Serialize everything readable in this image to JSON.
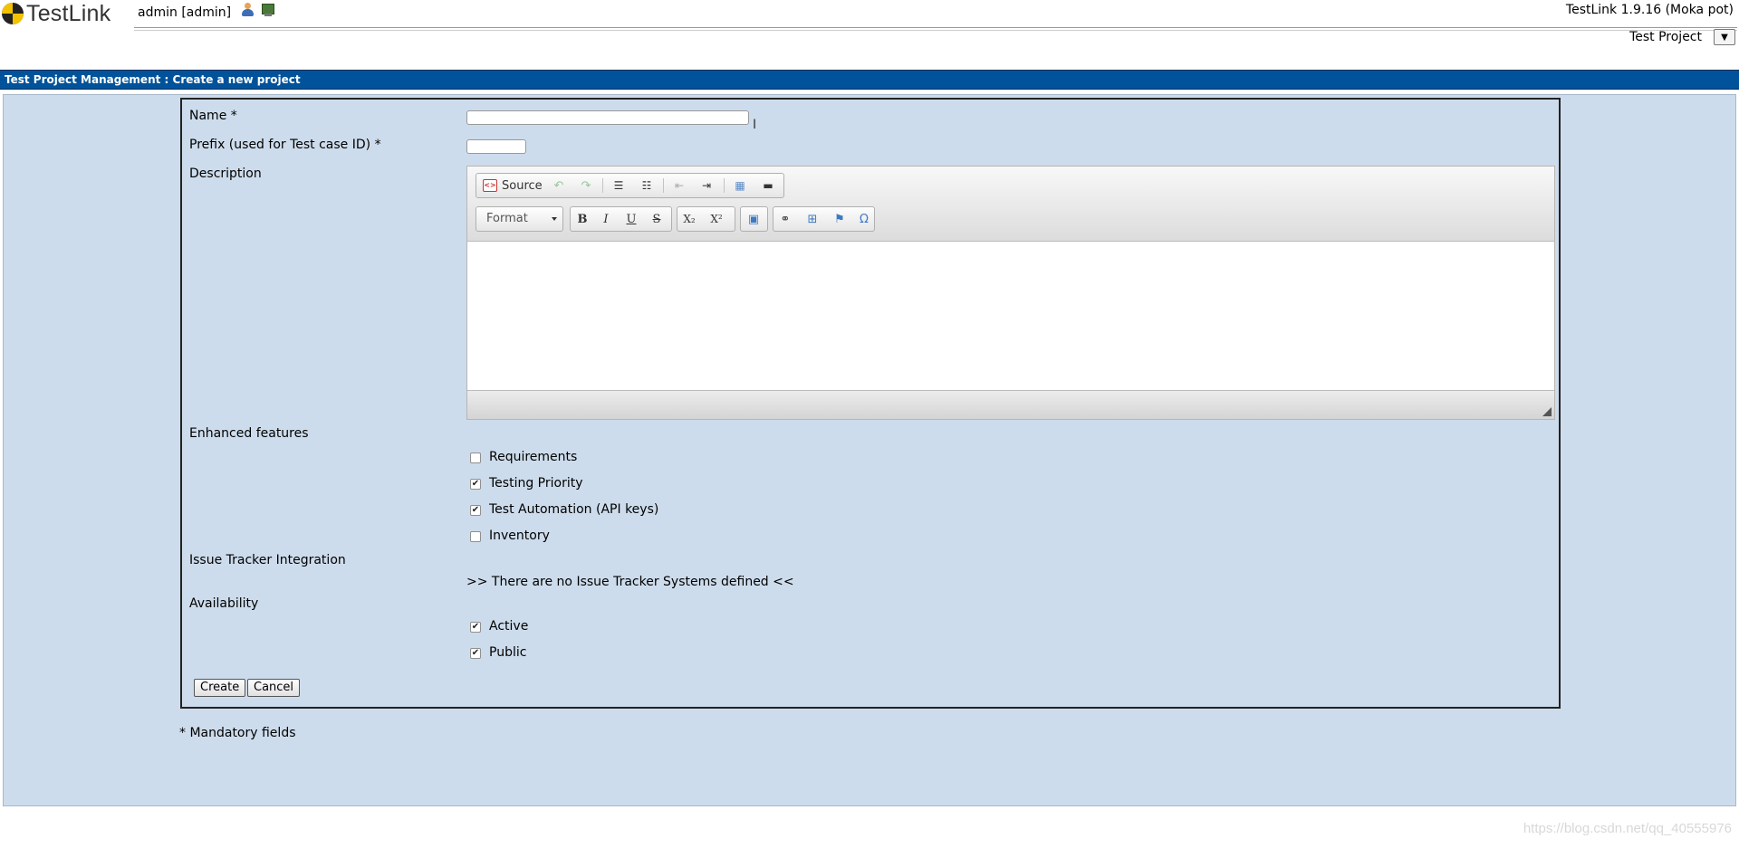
{
  "header": {
    "logo_text": "TestLink",
    "username": "admin [admin]",
    "version": "TestLink 1.9.16 (Moka pot)",
    "project_label": "Test Project",
    "project_select_icon": "▼"
  },
  "titlebar": {
    "text": "Test Project Management : Create a new project"
  },
  "form": {
    "name_label": "Name *",
    "name_value": "",
    "prefix_label": "Prefix (used for Test case ID) *",
    "prefix_value": "",
    "description_label": "Description",
    "editor": {
      "source_label": "Source",
      "format_label": "Format",
      "toolbar_icons": [
        "source-icon",
        "undo-icon",
        "redo-icon",
        "numbered-list-icon",
        "bulleted-list-icon",
        "outdent-icon",
        "indent-icon",
        "table-icon",
        "horizontal-rule-icon",
        "bold-icon",
        "italic-icon",
        "underline-icon",
        "strikethrough-icon",
        "subscript-icon",
        "superscript-icon",
        "image-icon",
        "link-icon",
        "insert-box-icon",
        "anchor-flag-icon",
        "special-char-icon"
      ]
    },
    "enhanced_label": "Enhanced features",
    "features": [
      {
        "label": "Requirements",
        "checked": false
      },
      {
        "label": "Testing Priority",
        "checked": true
      },
      {
        "label": "Test Automation (API keys)",
        "checked": true
      },
      {
        "label": "Inventory",
        "checked": false
      }
    ],
    "issue_tracker_label": "Issue Tracker Integration",
    "issue_tracker_text": ">> There are no Issue Tracker Systems defined <<",
    "availability_label": "Availability",
    "availability": [
      {
        "label": "Active",
        "checked": true
      },
      {
        "label": "Public",
        "checked": true
      }
    ],
    "create_label": "Create",
    "cancel_label": "Cancel"
  },
  "mandatory_note": "* Mandatory fields",
  "watermark": "https://blog.csdn.net/qq_40555976"
}
